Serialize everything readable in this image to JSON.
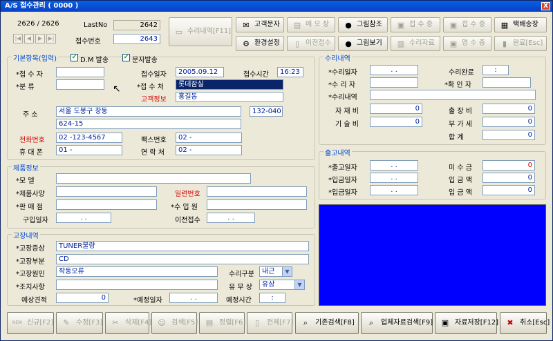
{
  "window": {
    "title": "A/S 접수관리 ( 0000 )",
    "close": "X"
  },
  "top": {
    "record": "2626 / 2626",
    "lastno_label": "LastNo",
    "lastno": "2642",
    "recv_no_label": "접수번호",
    "recv_no": "2643"
  },
  "nav": [
    "|◀",
    "◀",
    "▶",
    "▶|"
  ],
  "toolbar": {
    "repair_history": "수리내역[F11]",
    "sms": "고객문자",
    "memo": "메 모 장",
    "photo_ref": "그림참조",
    "receipt1": "접 수 증",
    "receipt2": "접 수 증",
    "courier": "택배송장",
    "env": "환경설정",
    "prev_receipt": "이전접수",
    "photo_view": "그림보기",
    "repair_doc": "수리자료",
    "receipt3": "영 수 증",
    "receipt4": "영 수 증",
    "done": "완료[Esc]"
  },
  "basic": {
    "title": "기본항목(입력)",
    "dm_label": "D.M 발송",
    "sms_label": "문자발송",
    "check": "✔",
    "receiver_label": "*접 수 자",
    "category_label": "*분    류",
    "recv_date_label": "접수일자",
    "recv_date": "2005.09.12",
    "recv_time_label": "접수시간",
    "recv_time": "16:23",
    "recv_place_label": "*접 수 처",
    "recv_place": "롯데잠실",
    "customer_label": "고객정보",
    "customer": "홍길동",
    "address_label": "주      소",
    "address1": "서울 도봉구 창동",
    "zip": "132-040",
    "address2": "624-15",
    "phone_label": "전화번호",
    "phone": "02  -123-4567",
    "fax_label": "팩스번호",
    "fax": "02  -",
    "mobile_label": "휴 대 폰",
    "mobile": "01 -",
    "contact_label": "연 락 처",
    "contact": "02 -"
  },
  "product": {
    "title": "제품정보",
    "model_label": "*모      델",
    "spec_label": "*제품사양",
    "serial_label": "일련번호",
    "shop_label": "*판 매 점",
    "importer_label": "*수 입 원",
    "purchase_label": "구입일자",
    "purchase": " .   .",
    "prev_label": "이전접수",
    "prev": " .   ."
  },
  "fault": {
    "title": "고장내역",
    "symptom_label": "*고장증상",
    "symptom": "TUNER불량",
    "part_label": "*고장부분",
    "part": "CD",
    "cause_label": "*고장원인",
    "cause": "작동오류",
    "action_label": "*조치사항",
    "repair_type_label": "수리구분",
    "repair_type": "내근",
    "paid_label": "유 무 상",
    "paid": "유상",
    "estimate_label": "예상견적",
    "estimate": "0",
    "planned_date_label": "*예정일자",
    "planned_date": " .   .",
    "planned_time_label": "예정시간",
    "planned_time": ":"
  },
  "repair": {
    "title": "수리내역",
    "date_label": "*수리일자",
    "date": " .   .",
    "done_label": "수리완료",
    "done": ":",
    "person_label": "*수 리 자",
    "confirm_label": "*확 인 자",
    "detail_label": "*수리내역",
    "material_label": "자 재 비",
    "material": "0",
    "travel_label": "출 장 비",
    "travel": "0",
    "tech_label": "기 술 비",
    "tech": "0",
    "vat_label": "부 가 세",
    "vat": "0",
    "total_label": "합      계",
    "total": "0"
  },
  "release": {
    "title": "출고내역",
    "out_date_label": "*출고일자",
    "out_date": " .   .",
    "unpaid_label": "미 수 금",
    "unpaid": "0",
    "pay1_label": "*입금일자",
    "pay1": " .   .",
    "amt1_label": "입 금 액",
    "amt1": "0",
    "pay2_label": "*입금일자",
    "pay2": " .   .",
    "amt2_label": "입 금 액",
    "amt2": "0"
  },
  "bottom": {
    "new": "신규[F2]",
    "edit": "수정[F3]",
    "delete": "삭제[F4]",
    "search": "검색[F5]",
    "sort": "정렬[F6]",
    "all": "전체[F7]",
    "base_search": "기존검색[F8]",
    "company_search": "업체자료검색[F9]",
    "save": "자료저장[F12]",
    "cancel": "취소[Esc]",
    "new_tag": "NEW"
  },
  "colors": {
    "title_bar": "#0841c8",
    "section_title": "#0046d5",
    "panel": "#0000ff"
  }
}
